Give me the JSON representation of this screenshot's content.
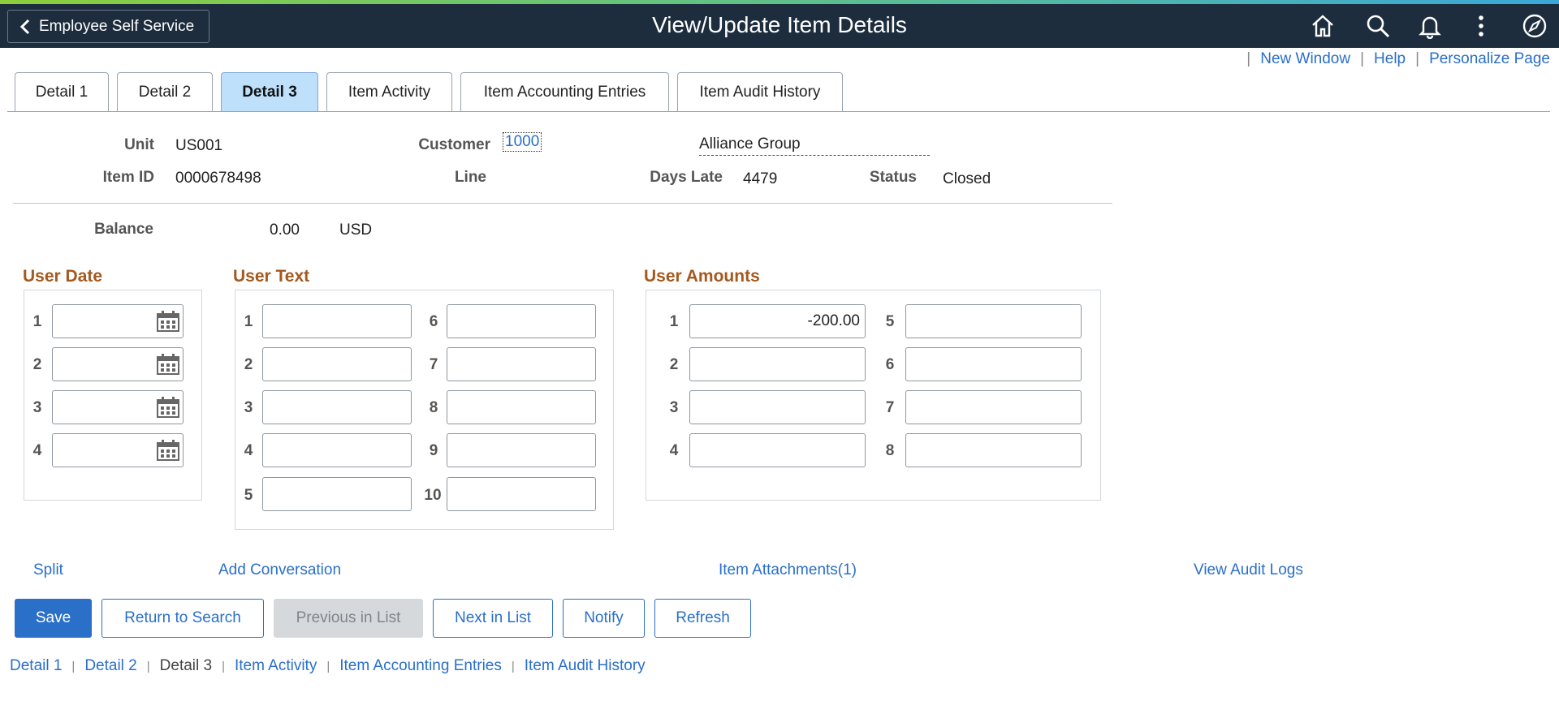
{
  "header": {
    "back_label": "Employee Self Service",
    "title": "View/Update Item Details",
    "icons": [
      "home-icon",
      "search-icon",
      "bell-icon",
      "more-icon",
      "navbar-icon"
    ]
  },
  "top_links": {
    "new_window": "New Window",
    "help": "Help",
    "personalize": "Personalize Page",
    "separator": "|"
  },
  "tabs": [
    {
      "label": "Detail 1",
      "active": false
    },
    {
      "label": "Detail 2",
      "active": false
    },
    {
      "label": "Detail 3",
      "active": true
    },
    {
      "label": "Item Activity",
      "active": false
    },
    {
      "label": "Item Accounting Entries",
      "active": false
    },
    {
      "label": "Item Audit History",
      "active": false
    }
  ],
  "item": {
    "unit_label": "Unit",
    "unit": "US001",
    "customer_label": "Customer",
    "customer_id": "1000",
    "customer_name": "Alliance Group",
    "item_id_label": "Item ID",
    "item_id": "0000678498",
    "line_label": "Line",
    "line": "",
    "days_late_label": "Days Late",
    "days_late": "4479",
    "status_label": "Status",
    "status": "Closed",
    "balance_label": "Balance",
    "balance": "0.00",
    "currency": "USD"
  },
  "user_date": {
    "title": "User Date",
    "rows": [
      "1",
      "2",
      "3",
      "4"
    ]
  },
  "user_text": {
    "title": "User Text",
    "left": [
      "1",
      "2",
      "3",
      "4",
      "5"
    ],
    "right": [
      "6",
      "7",
      "8",
      "9",
      "10"
    ]
  },
  "user_amounts": {
    "title": "User Amounts",
    "left": [
      {
        "n": "1",
        "v": "-200.00"
      },
      {
        "n": "2",
        "v": ""
      },
      {
        "n": "3",
        "v": ""
      },
      {
        "n": "4",
        "v": ""
      }
    ],
    "right": [
      {
        "n": "5",
        "v": ""
      },
      {
        "n": "6",
        "v": ""
      },
      {
        "n": "7",
        "v": ""
      },
      {
        "n": "8",
        "v": ""
      }
    ]
  },
  "action_links": {
    "split": "Split",
    "add_conversation": "Add Conversation",
    "attachments": "Item Attachments(1)",
    "audit_logs": "View Audit Logs"
  },
  "buttons": {
    "save": "Save",
    "return": "Return to Search",
    "previous": "Previous in List",
    "next": "Next in List",
    "notify": "Notify",
    "refresh": "Refresh"
  },
  "bottom_nav": [
    "Detail 1",
    "Detail 2",
    "Detail 3",
    "Item Activity",
    "Item Accounting Entries",
    "Item Audit History"
  ],
  "colors": {
    "header_bg": "#1d2d3e",
    "link": "#2a6fc9",
    "section_title": "#a4591e",
    "active_tab": "#bfe0fb",
    "primary": "#2a70c8"
  }
}
